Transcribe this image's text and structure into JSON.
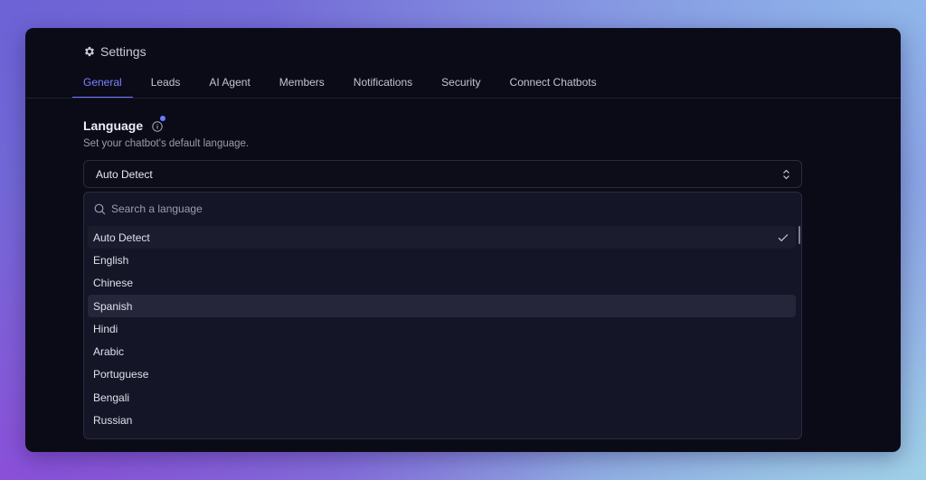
{
  "header": {
    "title": "Settings",
    "icon": "gear-icon"
  },
  "tabs": [
    {
      "label": "General",
      "active": true
    },
    {
      "label": "Leads",
      "active": false
    },
    {
      "label": "AI Agent",
      "active": false
    },
    {
      "label": "Members",
      "active": false
    },
    {
      "label": "Notifications",
      "active": false
    },
    {
      "label": "Security",
      "active": false
    },
    {
      "label": "Connect Chatbots",
      "active": false
    }
  ],
  "language": {
    "title": "Language",
    "description": "Set your chatbot's default language.",
    "selected_value": "Auto Detect",
    "search_placeholder": "Search a language",
    "options": [
      "Auto Detect",
      "English",
      "Chinese",
      "Spanish",
      "Hindi",
      "Arabic",
      "Portuguese",
      "Bengali",
      "Russian"
    ],
    "selected_option": "Auto Detect",
    "hovered_option": "Spanish"
  },
  "colors": {
    "accent": "#6f78ff",
    "window_bg": "#0b0b18",
    "dropdown_bg": "#141526"
  }
}
